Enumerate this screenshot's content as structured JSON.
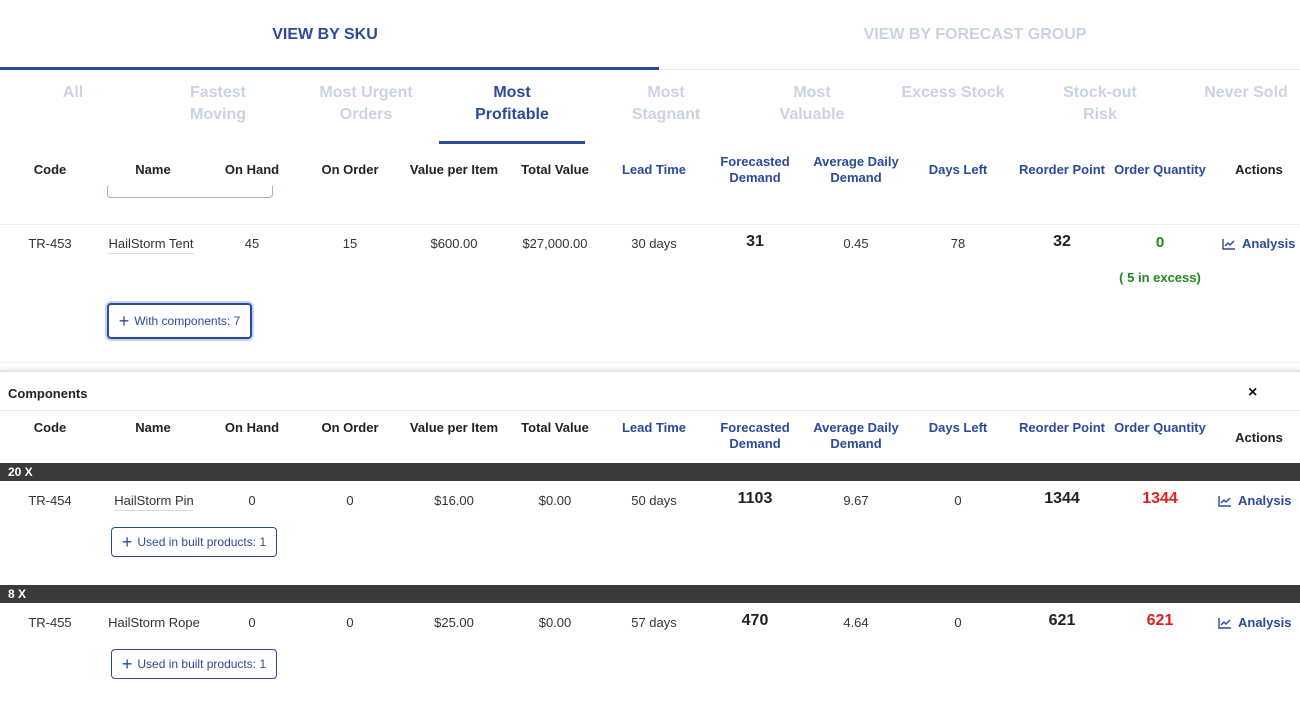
{
  "view_tabs": [
    {
      "label": "VIEW BY SKU",
      "active": true
    },
    {
      "label": "VIEW BY FORECAST GROUP",
      "active": false
    }
  ],
  "filter_tabs": [
    "All",
    "Fastest Moving",
    "Most Urgent Orders",
    "Most Profitable",
    "Most Stagnant",
    "Most Valuable",
    "Excess Stock",
    "Stock-out Risk",
    "Never Sold"
  ],
  "active_filter": "Most Profitable",
  "columns": {
    "code": "Code",
    "name": "Name",
    "on_hand": "On Hand",
    "on_order": "On Order",
    "value_per_item": "Value per Item",
    "total_value": "Total Value",
    "lead_time": "Lead Time",
    "forecasted_demand": "Forecasted Demand",
    "average_daily_demand": "Average Daily Demand",
    "days_left": "Days Left",
    "reorder_point": "Reorder Point",
    "order_quantity": "Order Quantity",
    "actions": "Actions"
  },
  "main_row": {
    "code": "TR-453",
    "name": "HailStorm Tent",
    "on_hand": "45",
    "on_order": "15",
    "value_per_item": "$600.00",
    "total_value": "$27,000.00",
    "lead_time": "30 days",
    "forecasted_demand": "31",
    "average_daily_demand": "0.45",
    "days_left": "78",
    "reorder_point": "32",
    "order_quantity": "0",
    "excess_note": "( 5 in excess)",
    "action": "Analysis",
    "components_button": "With components: 7"
  },
  "components_panel": {
    "title": "Components",
    "close": "×",
    "rows": [
      {
        "group": "20 X",
        "code": "TR-454",
        "name": "HailStorm Pin",
        "on_hand": "0",
        "on_order": "0",
        "value_per_item": "$16.00",
        "total_value": "$0.00",
        "lead_time": "50 days",
        "forecasted_demand": "1103",
        "average_daily_demand": "9.67",
        "days_left": "0",
        "reorder_point": "1344",
        "order_quantity": "1344",
        "action": "Analysis",
        "used_button": "Used in built products: 1"
      },
      {
        "group": "8 X",
        "code": "TR-455",
        "name": "HailStorm Rope",
        "on_hand": "0",
        "on_order": "0",
        "value_per_item": "$25.00",
        "total_value": "$0.00",
        "lead_time": "57 days",
        "forecasted_demand": "470",
        "average_daily_demand": "4.64",
        "days_left": "0",
        "reorder_point": "621",
        "order_quantity": "621",
        "action": "Analysis",
        "used_button": "Used in built products: 1"
      }
    ]
  },
  "colors": {
    "accent": "#2b4a9a",
    "inactive": "#c9d3e6",
    "excess_green": "#1f8a1f",
    "shortage_red": "#e02020",
    "group_bar": "#3a3a3a"
  },
  "icons": {
    "analysis": "line-chart-icon",
    "plus": "plus-icon",
    "close": "close-icon"
  }
}
